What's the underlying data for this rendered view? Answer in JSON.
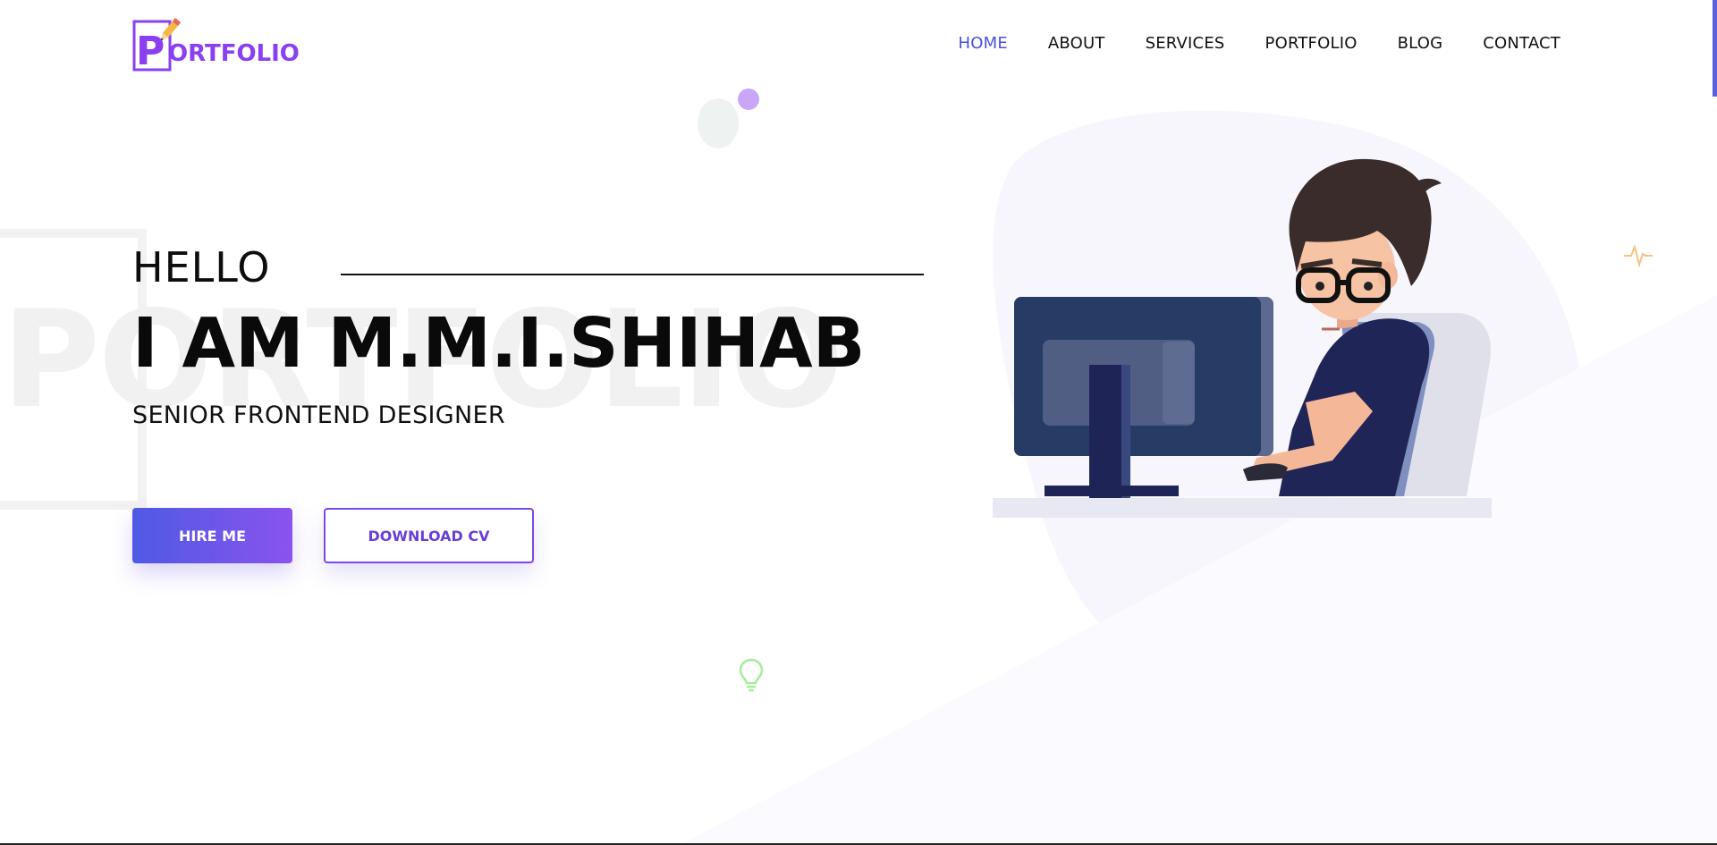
{
  "header": {
    "logo": {
      "letter": "P",
      "text": "ORTFOLIO"
    },
    "nav": [
      {
        "label": "HOME",
        "active": true
      },
      {
        "label": "ABOUT",
        "active": false
      },
      {
        "label": "SERVICES",
        "active": false
      },
      {
        "label": "PORTFOLIO",
        "active": false
      },
      {
        "label": "BLOG",
        "active": false
      },
      {
        "label": "CONTACT",
        "active": false
      }
    ]
  },
  "hero": {
    "watermark": "PORTFOLIO",
    "greeting": "HELLO",
    "name": "I AM M.M.I.SHIHAB",
    "role": "SENIOR FRONTEND DESIGNER",
    "hire_label": "HIRE ME",
    "cv_label": "DOWNLOAD CV"
  },
  "icons": {
    "logo": "pencil-icon",
    "decor": [
      "pulse-icon",
      "lightbulb-icon"
    ]
  },
  "colors": {
    "accent": "#4a50d8",
    "button_gradient_start": "#4e5ae4",
    "button_gradient_end": "#8a53ee",
    "outline_button": "#7c48e8",
    "logo_purple": "#8a3ff0"
  }
}
